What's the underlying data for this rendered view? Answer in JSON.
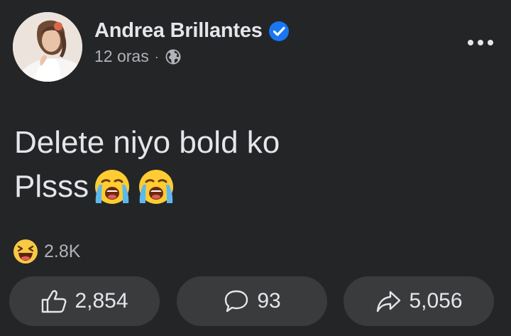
{
  "author": {
    "name": "Andrea Brillantes",
    "verified": true
  },
  "meta": {
    "time": "12 oras",
    "separator": "·",
    "privacy_icon": "globe-icon"
  },
  "post": {
    "line1": "Delete niyo bold ko",
    "line2": "Plsss",
    "emojis": [
      "loudly-crying-face",
      "loudly-crying-face"
    ]
  },
  "reactions": {
    "icon": "haha-icon",
    "count": "2.8K"
  },
  "actions": {
    "like_count": "2,854",
    "comment_count": "93",
    "share_count": "5,056"
  },
  "colors": {
    "background": "#242526",
    "text": "#e4e6eb",
    "muted": "#b0b3b8",
    "button": "#3a3b3c",
    "verified": "#1877f2"
  }
}
